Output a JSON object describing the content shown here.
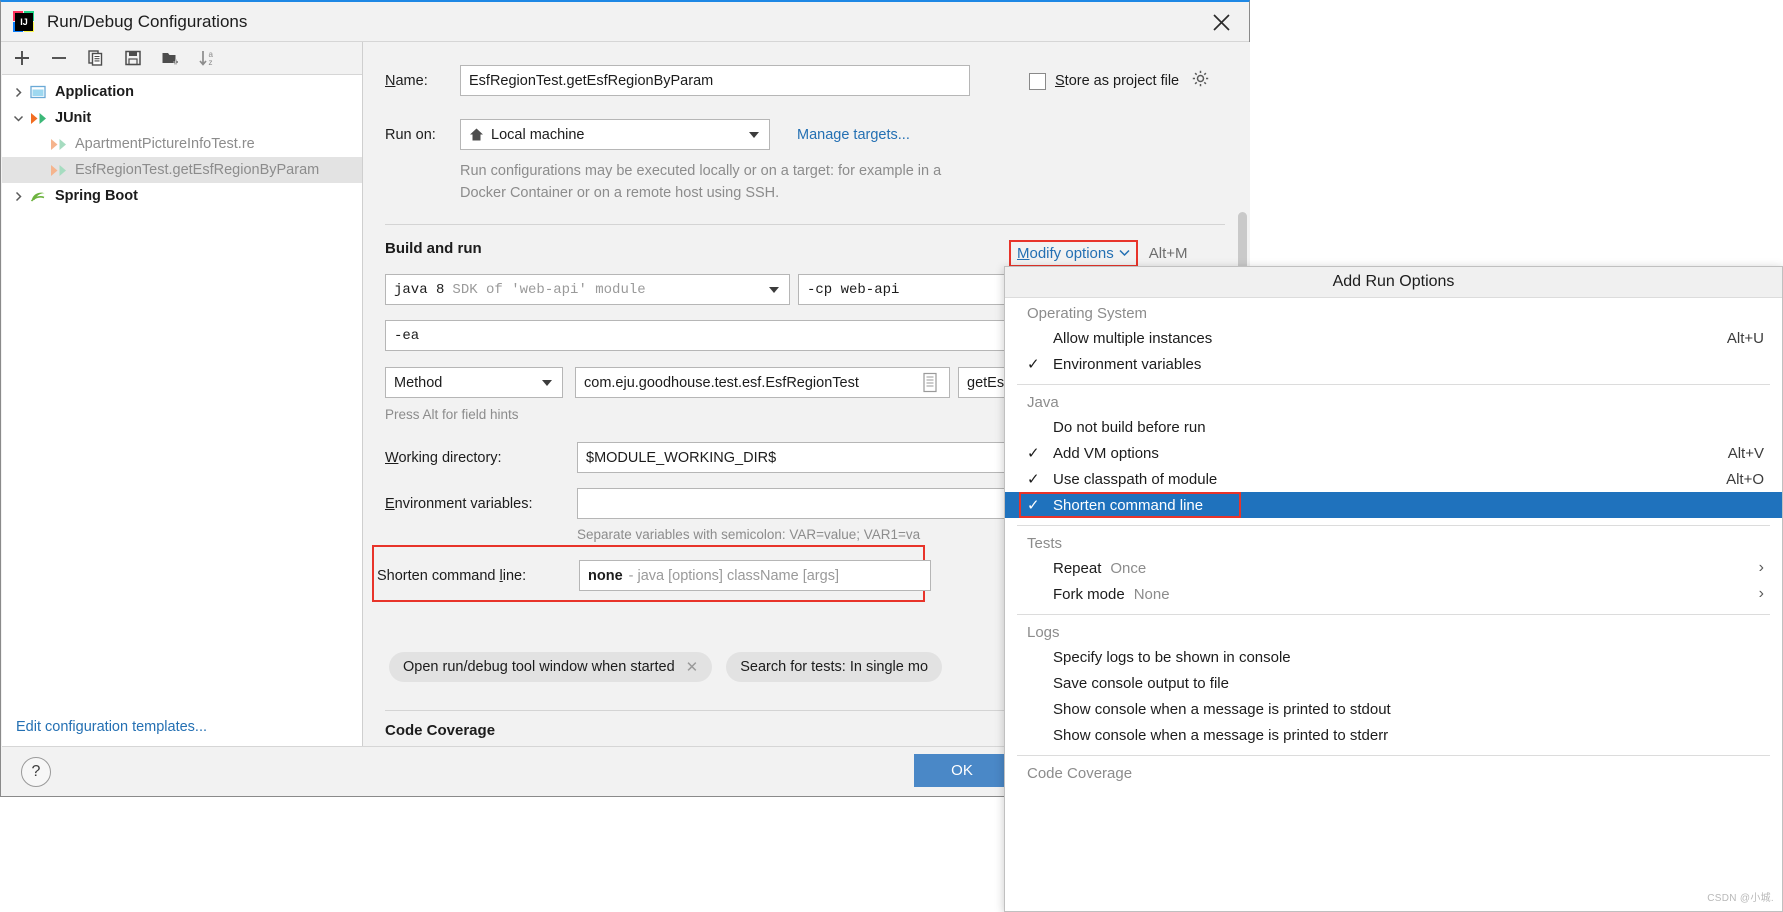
{
  "window": {
    "title": "Run/Debug Configurations",
    "app_icon": "intellij-idea-icon",
    "close_icon": "close-icon"
  },
  "toolbar": {
    "buttons": [
      {
        "name": "add-configuration-button",
        "icon": "plus-icon"
      },
      {
        "name": "remove-configuration-button",
        "icon": "minus-icon"
      },
      {
        "name": "copy-configuration-button",
        "icon": "copy-icon"
      },
      {
        "name": "save-configuration-button",
        "icon": "save-icon"
      },
      {
        "name": "move-to-folder-button",
        "icon": "folder-add-icon"
      },
      {
        "name": "sort-configurations-button",
        "icon": "sort-az-icon"
      }
    ]
  },
  "tree": {
    "nodes": [
      {
        "label": "Application",
        "type": "group",
        "expanded": false,
        "icon": "application-icon"
      },
      {
        "label": "JUnit",
        "type": "group",
        "expanded": true,
        "icon": "junit-icon"
      },
      {
        "label": "ApartmentPictureInfoTest.re",
        "type": "child",
        "icon": "junit-run-icon",
        "selected": false
      },
      {
        "label": "EsfRegionTest.getEsfRegionByParam",
        "type": "child",
        "icon": "junit-run-icon",
        "selected": true
      },
      {
        "label": "Spring Boot",
        "type": "group",
        "expanded": false,
        "icon": "spring-boot-icon"
      }
    ],
    "edit_templates_link": "Edit configuration templates..."
  },
  "form": {
    "name_label": "Name:",
    "name_label_mnemonic": "N",
    "name_value": "EsfRegionTest.getEsfRegionByParam",
    "store_as_project_file_label": "Store as project file",
    "store_as_project_file_mnemonic": "S",
    "store_as_project_file_checked": false,
    "store_gear_icon": "gear-icon",
    "run_on_label": "Run on:",
    "run_on_value": "Local machine",
    "run_on_icon": "home-icon",
    "manage_targets_link": "Manage targets...",
    "run_on_description": "Run configurations may be executed locally or on a target: for example in a Docker Container or on a remote host using SSH.",
    "build_and_run_title": "Build and run",
    "modify_options_link": "Modify options",
    "modify_options_mnemonic": "M",
    "modify_options_shortcut": "Alt+M",
    "sdk_value": "java 8",
    "sdk_suffix": "SDK of 'web-api' module",
    "classpath_value": "-cp web-api",
    "vm_options_value": "-ea",
    "test_kind_value": "Method",
    "class_value": "com.eju.goodhouse.test.esf.EsfRegionTest",
    "class_browse_icon": "browse-icon",
    "method_value": "getEs",
    "alt_hint": "Press Alt for field hints",
    "working_directory_label": "Working directory:",
    "working_directory_mnemonic": "W",
    "working_directory_value": "$MODULE_WORKING_DIR$",
    "environment_variables_label": "Environment variables:",
    "environment_variables_mnemonic": "E",
    "environment_variables_value": "",
    "environment_variables_hint": "Separate variables with semicolon: VAR=value; VAR1=va",
    "shorten_command_line_label": "Shorten command line:",
    "shorten_command_line_mnemonic": "l",
    "shorten_command_line_value": "none",
    "shorten_command_line_value_suffix": "- java [options] className [args]",
    "chips": [
      {
        "label": "Open run/debug tool window when started",
        "closable": true
      },
      {
        "label": "Search for tests: In single mo",
        "closable": false
      }
    ],
    "code_coverage_title": "Code Coverage"
  },
  "footer": {
    "help_label": "?",
    "ok_label": "OK"
  },
  "popup": {
    "title": "Add Run Options",
    "groups": [
      {
        "label": "Operating System",
        "items": [
          {
            "label": "Allow multiple instances",
            "checked": false,
            "shortcut": "Alt+U",
            "selected": false
          },
          {
            "label": "Environment variables",
            "checked": true,
            "shortcut": "",
            "selected": false
          }
        ]
      },
      {
        "label": "Java",
        "items": [
          {
            "label": "Do not build before run",
            "checked": false,
            "shortcut": "",
            "selected": false
          },
          {
            "label": "Add VM options",
            "checked": true,
            "shortcut": "Alt+V",
            "selected": false
          },
          {
            "label": "Use classpath of module",
            "checked": true,
            "shortcut": "Alt+O",
            "selected": false
          },
          {
            "label": "Shorten command line",
            "checked": true,
            "shortcut": "",
            "selected": true
          }
        ]
      },
      {
        "label": "Tests",
        "items": [
          {
            "label": "Repeat",
            "checked": false,
            "value": "Once",
            "submenu": true,
            "selected": false
          },
          {
            "label": "Fork mode",
            "checked": false,
            "value": "None",
            "submenu": true,
            "selected": false
          }
        ]
      },
      {
        "label": "Logs",
        "items": [
          {
            "label": "Specify logs to be shown in console",
            "checked": false,
            "shortcut": "",
            "selected": false
          },
          {
            "label": "Save console output to file",
            "checked": false,
            "shortcut": "",
            "selected": false
          },
          {
            "label": "Show console when a message is printed to stdout",
            "checked": false,
            "shortcut": "",
            "selected": false
          },
          {
            "label": "Show console when a message is printed to stderr",
            "checked": false,
            "shortcut": "",
            "selected": false
          }
        ]
      },
      {
        "label": "Code Coverage",
        "items": []
      }
    ],
    "checkmark_glyph": "✓",
    "submenu_glyph": "›"
  },
  "watermark": "CSDN @小城.",
  "colors": {
    "accent_blue": "#2470b3",
    "selection_blue": "#1f72bd",
    "highlight_red": "#e8342a",
    "ok_button": "#4a88c7",
    "panel_bg": "#f2f2f2",
    "titlebar_accent": "#1e88e5"
  }
}
